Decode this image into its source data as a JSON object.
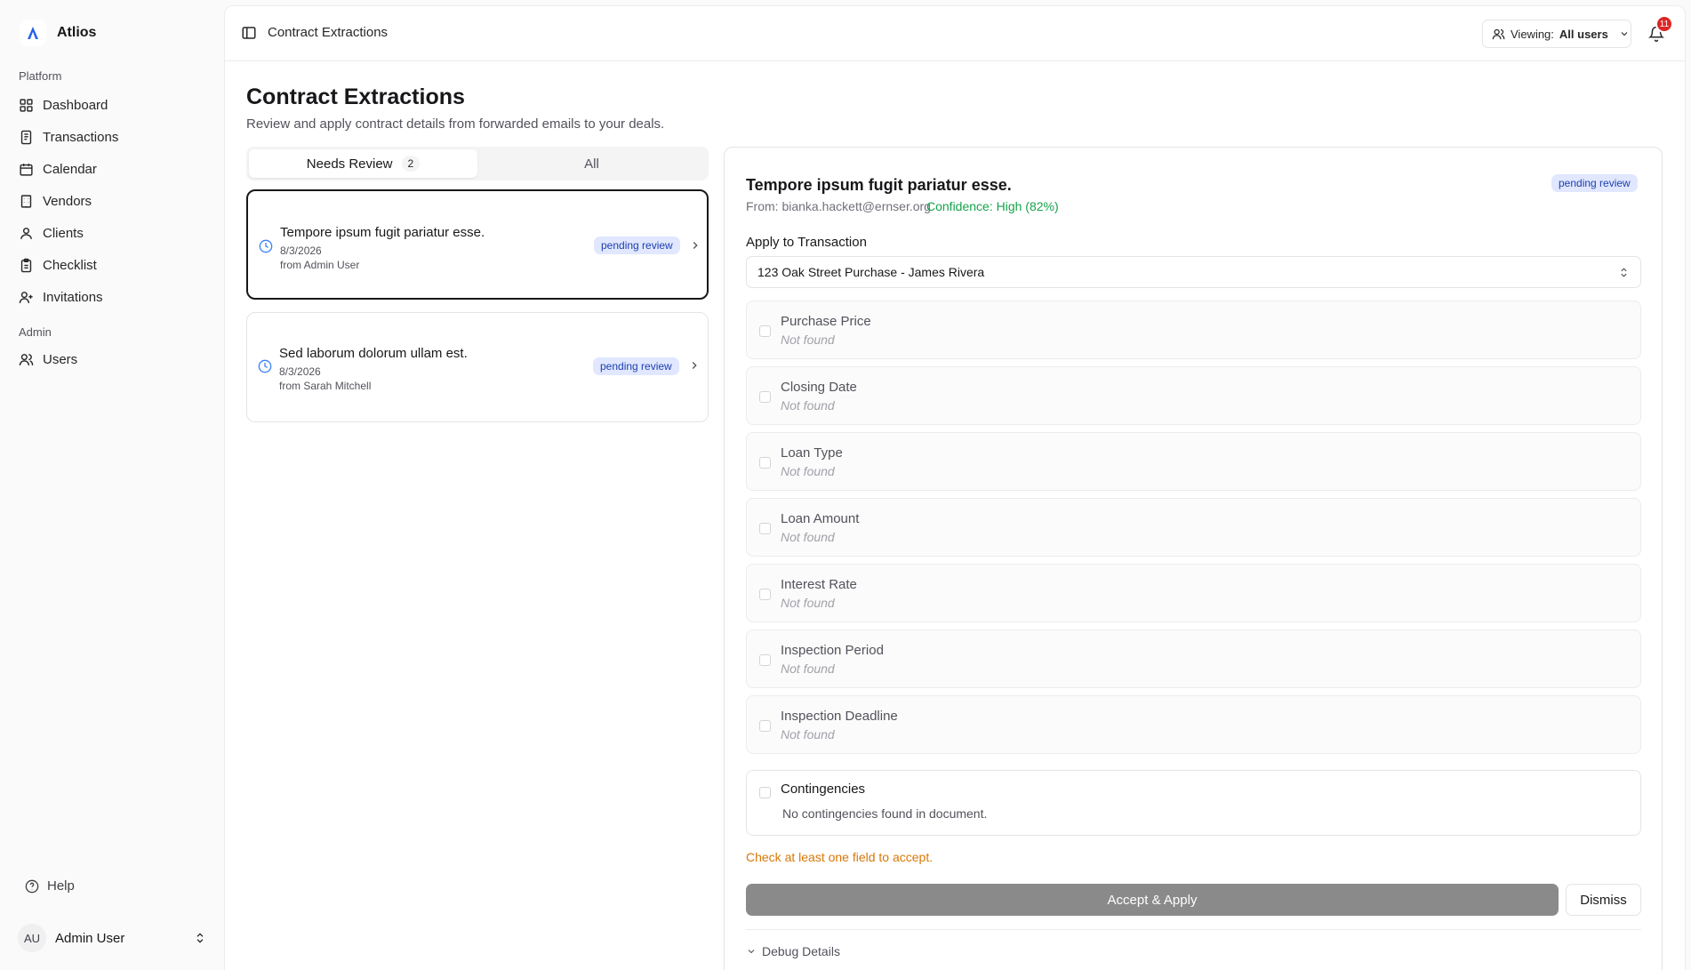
{
  "brand": {
    "name": "Atlios"
  },
  "sidebar": {
    "platform_label": "Platform",
    "items": [
      {
        "label": "Dashboard",
        "icon": "dashboard-icon"
      },
      {
        "label": "Transactions",
        "icon": "receipt-icon"
      },
      {
        "label": "Calendar",
        "icon": "calendar-icon"
      },
      {
        "label": "Vendors",
        "icon": "building-icon"
      },
      {
        "label": "Clients",
        "icon": "user-icon"
      },
      {
        "label": "Checklist",
        "icon": "clipboard-icon"
      },
      {
        "label": "Invitations",
        "icon": "user-plus-icon"
      }
    ],
    "admin_label": "Admin",
    "admin_items": [
      {
        "label": "Users",
        "icon": "users-icon"
      }
    ],
    "help_label": "Help",
    "user": {
      "initials": "AU",
      "name": "Admin User"
    }
  },
  "topbar": {
    "title": "Contract Extractions",
    "viewing_label": "Viewing:",
    "viewing_value": "All users",
    "notification_count": "11"
  },
  "page": {
    "title": "Contract Extractions",
    "subtitle": "Review and apply contract details from forwarded emails to your deals."
  },
  "tabs": [
    {
      "label": "Needs Review",
      "count": "2",
      "active": true
    },
    {
      "label": "All",
      "active": false
    }
  ],
  "extractions": [
    {
      "title": "Tempore ipsum fugit pariatur esse.",
      "date": "8/3/2026",
      "from": "from Admin User",
      "status": "pending review",
      "selected": true
    },
    {
      "title": "Sed laborum dolorum ullam est.",
      "date": "8/3/2026",
      "from": "from Sarah Mitchell",
      "status": "pending review",
      "selected": false
    }
  ],
  "detail": {
    "title": "Tempore ipsum fugit pariatur esse.",
    "status": "pending review",
    "from": "From: bianka.hackett@ernser.org",
    "confidence": "Confidence: High (82%)",
    "apply_label": "Apply to Transaction",
    "transaction": "123 Oak Street Purchase - James Rivera",
    "fields": [
      {
        "label": "Purchase Price",
        "value": "Not found"
      },
      {
        "label": "Closing Date",
        "value": "Not found"
      },
      {
        "label": "Loan Type",
        "value": "Not found"
      },
      {
        "label": "Loan Amount",
        "value": "Not found"
      },
      {
        "label": "Interest Rate",
        "value": "Not found"
      },
      {
        "label": "Inspection Period",
        "value": "Not found"
      },
      {
        "label": "Inspection Deadline",
        "value": "Not found"
      }
    ],
    "contingencies_label": "Contingencies",
    "contingencies_text": "No contingencies found in document.",
    "warning": "Check at least one field to accept.",
    "accept_label": "Accept & Apply",
    "dismiss_label": "Dismiss",
    "debug_label": "Debug Details"
  },
  "colors": {
    "accent_dark": "#18181b",
    "badge_bg": "#e0e7ff",
    "badge_text": "#1e40af",
    "confidence": "#16a34a",
    "warning": "#d97706",
    "notification": "#dc2626",
    "accept_disabled": "#8a8a8a"
  }
}
